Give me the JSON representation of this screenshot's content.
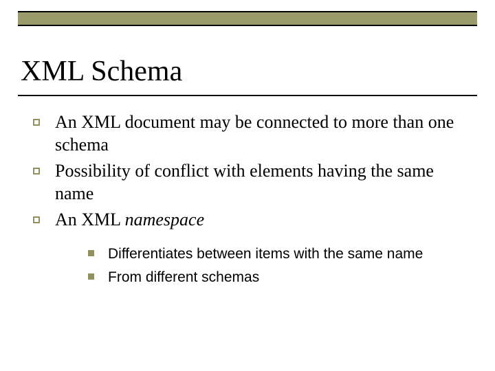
{
  "title": "XML Schema",
  "bullets": {
    "b1": "An XML document may be connected to more than one schema",
    "b2": "Possibility of conflict with elements having the same name",
    "b3a": "An XML ",
    "b3b": "namespace"
  },
  "subbullets": {
    "s1": "Differentiates between items with the same name",
    "s2": "From different schemas"
  }
}
